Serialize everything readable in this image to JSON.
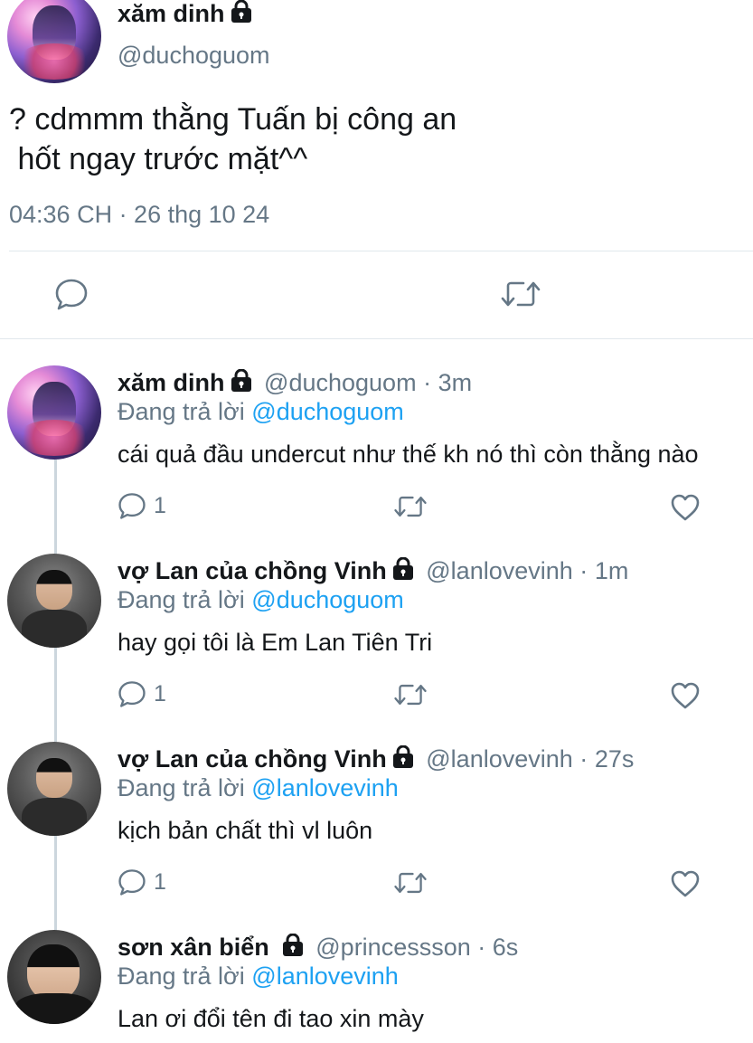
{
  "main_tweet": {
    "author_name": "xăm dinh",
    "author_handle": "@duchoguom",
    "text_line1": "? cdmmm thằng Tuấn bị công an",
    "text_line2": " hốt ngay trước mặt^^",
    "timestamp": "04:36 CH · 26 thg 10 24"
  },
  "replies": [
    {
      "name": "xăm dinh",
      "handle": "@duchoguom",
      "time": "3m",
      "replying_prefix": "Đang trả lời",
      "replying_to": "@duchoguom",
      "text": "cái quả đầu undercut như thế kh nó thì còn thằng nào",
      "reply_count": "1"
    },
    {
      "name": "vợ Lan của chồng Vinh",
      "handle": "@lanlovevinh",
      "time": "1m",
      "replying_prefix": "Đang trả lời",
      "replying_to": "@duchoguom",
      "text": "hay gọi tôi là Em Lan Tiên Tri",
      "reply_count": "1"
    },
    {
      "name": "vợ Lan của chồng Vinh",
      "handle": "@lanlovevinh",
      "time": "27s",
      "replying_prefix": "Đang trả lời",
      "replying_to": "@lanlovevinh",
      "text": "kịch bản chất thì vl luôn",
      "reply_count": "1"
    },
    {
      "name": "sơn xân biển",
      "handle": "@princessson",
      "time": "6s",
      "replying_prefix": "Đang trả lời",
      "replying_to": "@lanlovevinh",
      "text": "Lan ơi đổi tên đi tao xin mày"
    }
  ],
  "separator": "·",
  "colors": {
    "text": "#14171a",
    "muted": "#657786",
    "link": "#1da1f2",
    "divider": "#e1e8ed",
    "thread_line": "#ccd6dd"
  },
  "icons": [
    "comment-icon",
    "retweet-icon",
    "like-icon",
    "lock-icon"
  ]
}
